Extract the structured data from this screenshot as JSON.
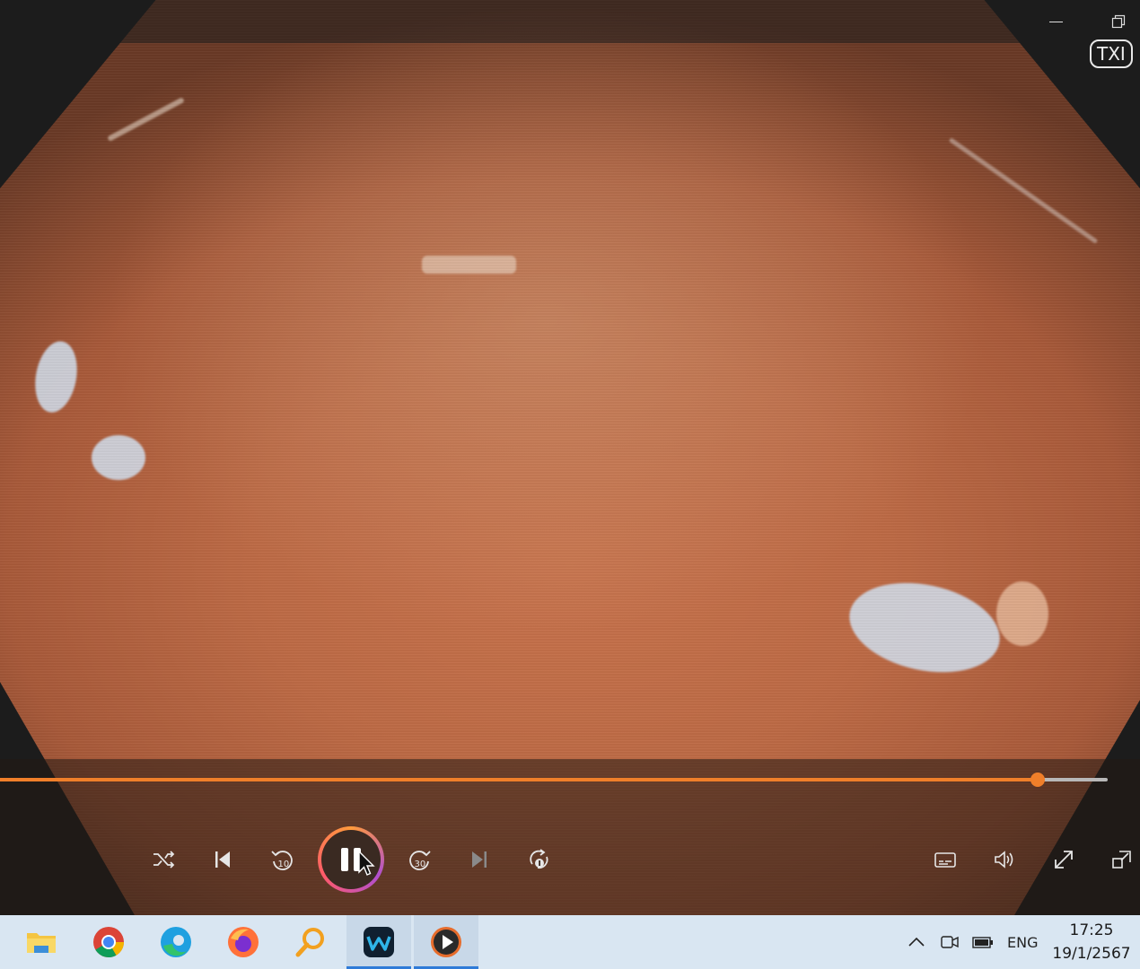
{
  "window": {
    "badge": "TXI"
  },
  "player": {
    "progress": 0.937,
    "skip_back_seconds": "10",
    "skip_forward_seconds": "30",
    "accent_color": "#f07f2a",
    "icons": [
      "shuffle-icon",
      "previous-icon",
      "rewind-10-icon",
      "pause-icon",
      "forward-30-icon",
      "next-icon",
      "repeat-one-icon",
      "captions-icon",
      "volume-icon",
      "fullscreen-icon",
      "mini-view-icon"
    ]
  },
  "taskbar": {
    "apps": [
      "file-explorer",
      "chrome",
      "edge",
      "firefox",
      "search-tool",
      "webex",
      "media-player"
    ],
    "tray": {
      "language": "ENG"
    },
    "clock": {
      "time": "17:25",
      "date": "19/1/2567"
    }
  }
}
